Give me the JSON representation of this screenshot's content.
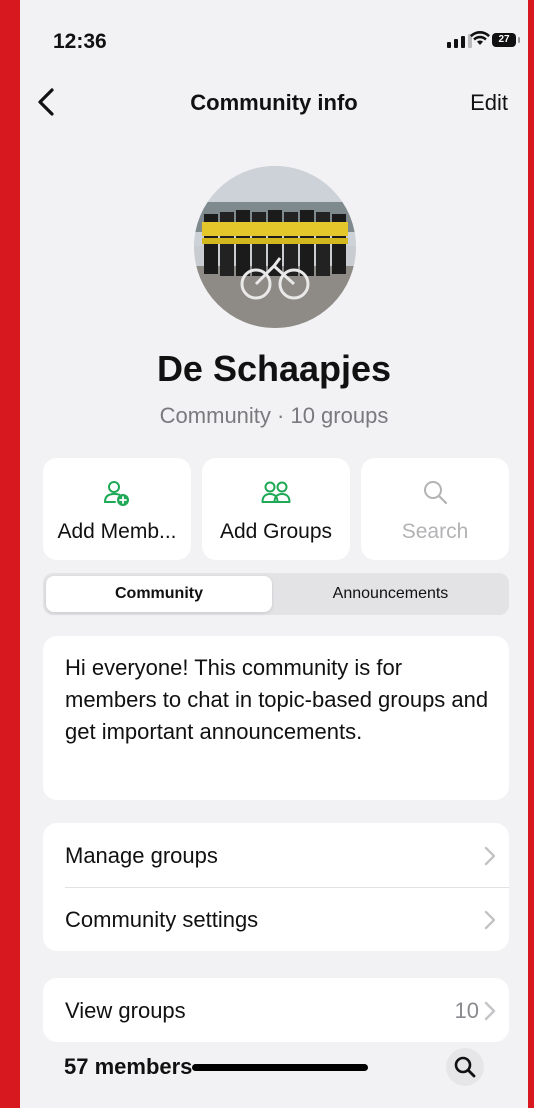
{
  "status_bar": {
    "time": "12:36",
    "battery": "27"
  },
  "nav": {
    "title": "Community info",
    "edit_label": "Edit"
  },
  "community": {
    "name": "De Schaapjes",
    "subtitle": "Community · 10 groups"
  },
  "actions": [
    {
      "label": "Add Memb...",
      "icon": "add-member-icon",
      "enabled": true
    },
    {
      "label": "Add Groups",
      "icon": "groups-icon",
      "enabled": true
    },
    {
      "label": "Search",
      "icon": "search-icon",
      "enabled": false
    }
  ],
  "tabs": {
    "active": "Community",
    "inactive": "Announcements"
  },
  "description": "Hi everyone! This community is for members to chat in topic-based groups and get important announcements.",
  "settings": {
    "manage_groups": "Manage groups",
    "community_settings": "Community settings"
  },
  "groups": {
    "view_label": "View groups",
    "count": "10"
  },
  "members": {
    "label": "57 members"
  },
  "colors": {
    "accent_green": "#1fa855",
    "background": "#f2f2f4",
    "frame": "#d7191f"
  }
}
